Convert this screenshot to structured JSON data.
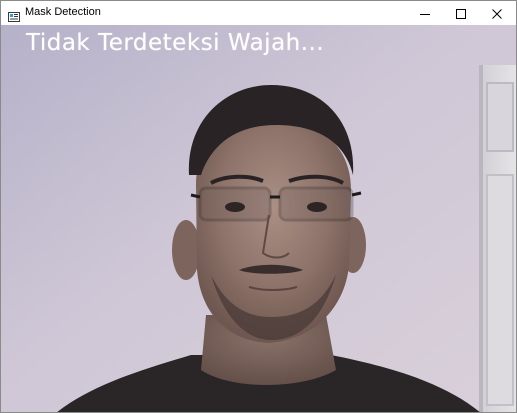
{
  "window": {
    "title": "Mask Detection",
    "icons": {
      "app": "window-app-icon",
      "minimize": "minimize-icon",
      "maximize": "maximize-icon",
      "close": "close-icon"
    }
  },
  "video": {
    "status_text": "Tidak Terdeteksi Wajah...",
    "status_color": "#ffffff"
  }
}
